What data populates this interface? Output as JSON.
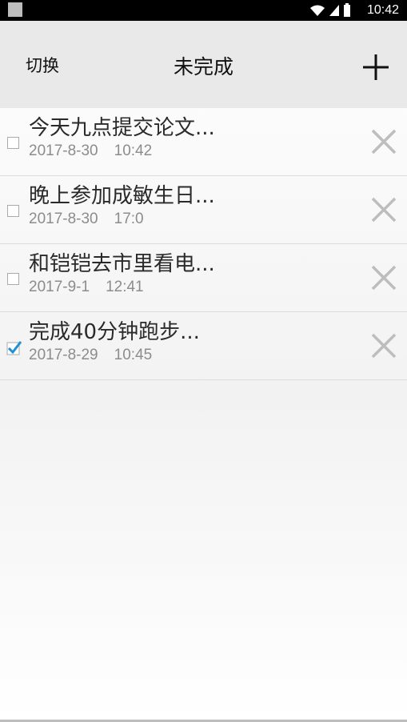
{
  "status_bar": {
    "time": "10:42",
    "icons": [
      "wifi-icon",
      "signal-icon",
      "battery-icon"
    ]
  },
  "app_bar": {
    "switch_label": "切换",
    "title": "未完成",
    "add_icon": "plus-icon"
  },
  "tasks": [
    {
      "title": "今天九点提交论文...",
      "date": "2017-8-30",
      "time": "10:42",
      "done": false
    },
    {
      "title": "晚上参加成敏生日...",
      "date": "2017-8-30",
      "time": "17:0",
      "done": false
    },
    {
      "title": "和铠铠去市里看电...",
      "date": "2017-9-1",
      "time": "12:41",
      "done": false
    },
    {
      "title": "完成40分钟跑步...",
      "date": "2017-8-29",
      "time": "10:45",
      "done": true
    }
  ],
  "colors": {
    "appbar": "#e9e9e9",
    "check_accent": "#1f8fd6",
    "delete_icon": "#bdbdbd"
  }
}
